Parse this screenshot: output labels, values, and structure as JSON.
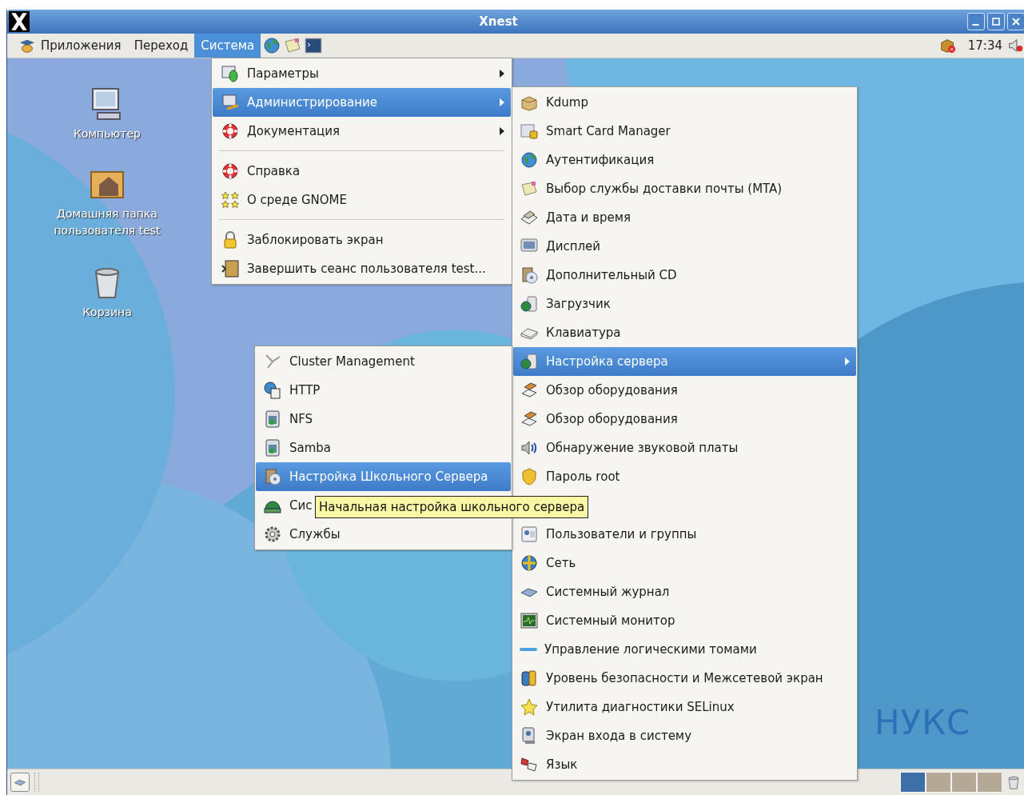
{
  "window": {
    "title": "Xnest"
  },
  "top_panel": {
    "menus": [
      {
        "label": "Приложения",
        "selected": false
      },
      {
        "label": "Переход",
        "selected": false
      },
      {
        "label": "Система",
        "selected": true
      }
    ],
    "clock": "17:34"
  },
  "desktop_icons": [
    {
      "label": "Компьютер"
    },
    {
      "label": "Домашняя папка пользователя test"
    },
    {
      "label": "Корзина"
    }
  ],
  "wallpaper_text": "НУКС",
  "system_menu": {
    "items": [
      {
        "kind": "item",
        "label": "Параметры",
        "has_submenu": true,
        "selected": false
      },
      {
        "kind": "item",
        "label": "Администрирование",
        "has_submenu": true,
        "selected": true
      },
      {
        "kind": "item",
        "label": "Документация",
        "has_submenu": true,
        "selected": false
      },
      {
        "kind": "separator"
      },
      {
        "kind": "item",
        "label": "Справка",
        "has_submenu": false,
        "selected": false
      },
      {
        "kind": "item",
        "label": "О среде GNOME",
        "has_submenu": false,
        "selected": false
      },
      {
        "kind": "separator"
      },
      {
        "kind": "item",
        "label": "Заблокировать экран",
        "has_submenu": false,
        "selected": false
      },
      {
        "kind": "item",
        "label": "Завершить сеанс пользователя test...",
        "has_submenu": false,
        "selected": false
      }
    ]
  },
  "admin_menu": {
    "items": [
      {
        "kind": "item",
        "label": "Kdump",
        "has_submenu": false,
        "selected": false
      },
      {
        "kind": "item",
        "label": "Smart Card Manager",
        "has_submenu": false,
        "selected": false
      },
      {
        "kind": "item",
        "label": "Аутентификация",
        "has_submenu": false,
        "selected": false
      },
      {
        "kind": "item",
        "label": "Выбор службы доставки почты (MTA)",
        "has_submenu": false,
        "selected": false
      },
      {
        "kind": "item",
        "label": "Дата и время",
        "has_submenu": false,
        "selected": false
      },
      {
        "kind": "item",
        "label": "Дисплей",
        "has_submenu": false,
        "selected": false
      },
      {
        "kind": "item",
        "label": "Дополнительный CD",
        "has_submenu": false,
        "selected": false
      },
      {
        "kind": "item",
        "label": "Загрузчик",
        "has_submenu": false,
        "selected": false
      },
      {
        "kind": "item",
        "label": "Клавиатура",
        "has_submenu": false,
        "selected": false
      },
      {
        "kind": "item",
        "label": "Настройка сервера",
        "has_submenu": true,
        "selected": true
      },
      {
        "kind": "item",
        "label": "Обзор оборудования",
        "has_submenu": false,
        "selected": false
      },
      {
        "kind": "item",
        "label": "Обзор оборудования",
        "has_submenu": false,
        "selected": false
      },
      {
        "kind": "item",
        "label": "Обнаружение звуковой платы",
        "has_submenu": false,
        "selected": false
      },
      {
        "kind": "item",
        "label": "Пароль root",
        "has_submenu": false,
        "selected": false
      },
      {
        "kind": "covered"
      },
      {
        "kind": "item",
        "label": "Пользователи и группы",
        "has_submenu": false,
        "selected": false
      },
      {
        "kind": "item",
        "label": "Сеть",
        "has_submenu": false,
        "selected": false
      },
      {
        "kind": "item",
        "label": "Системный журнал",
        "has_submenu": false,
        "selected": false
      },
      {
        "kind": "item",
        "label": "Системный монитор",
        "has_submenu": false,
        "selected": false
      },
      {
        "kind": "item",
        "label": "Управление логическими томами",
        "has_submenu": false,
        "selected": false
      },
      {
        "kind": "item",
        "label": "Уровень безопасности и Межсетевой экран",
        "has_submenu": false,
        "selected": false
      },
      {
        "kind": "item",
        "label": "Утилита диагностики SELinux",
        "has_submenu": false,
        "selected": false
      },
      {
        "kind": "item",
        "label": "Экран входа в систему",
        "has_submenu": false,
        "selected": false
      },
      {
        "kind": "item",
        "label": "Язык",
        "has_submenu": false,
        "selected": false
      }
    ]
  },
  "server_menu": {
    "items": [
      {
        "kind": "item",
        "label": "Cluster Management",
        "has_submenu": false,
        "selected": false
      },
      {
        "kind": "item",
        "label": "HTTP",
        "has_submenu": false,
        "selected": false
      },
      {
        "kind": "item",
        "label": "NFS",
        "has_submenu": false,
        "selected": false
      },
      {
        "kind": "item",
        "label": "Samba",
        "has_submenu": false,
        "selected": false
      },
      {
        "kind": "item",
        "label": "Настройка Школьного Сервера",
        "has_submenu": false,
        "selected": true
      },
      {
        "kind": "item",
        "label": "Сис",
        "has_submenu": false,
        "selected": false
      },
      {
        "kind": "item",
        "label": "Службы",
        "has_submenu": false,
        "selected": false
      }
    ]
  },
  "tooltip": {
    "text": "Начальная настройка школьного сервера"
  },
  "workspaces": [
    {
      "selected": true
    },
    {
      "selected": false
    },
    {
      "selected": false
    },
    {
      "selected": false
    }
  ]
}
